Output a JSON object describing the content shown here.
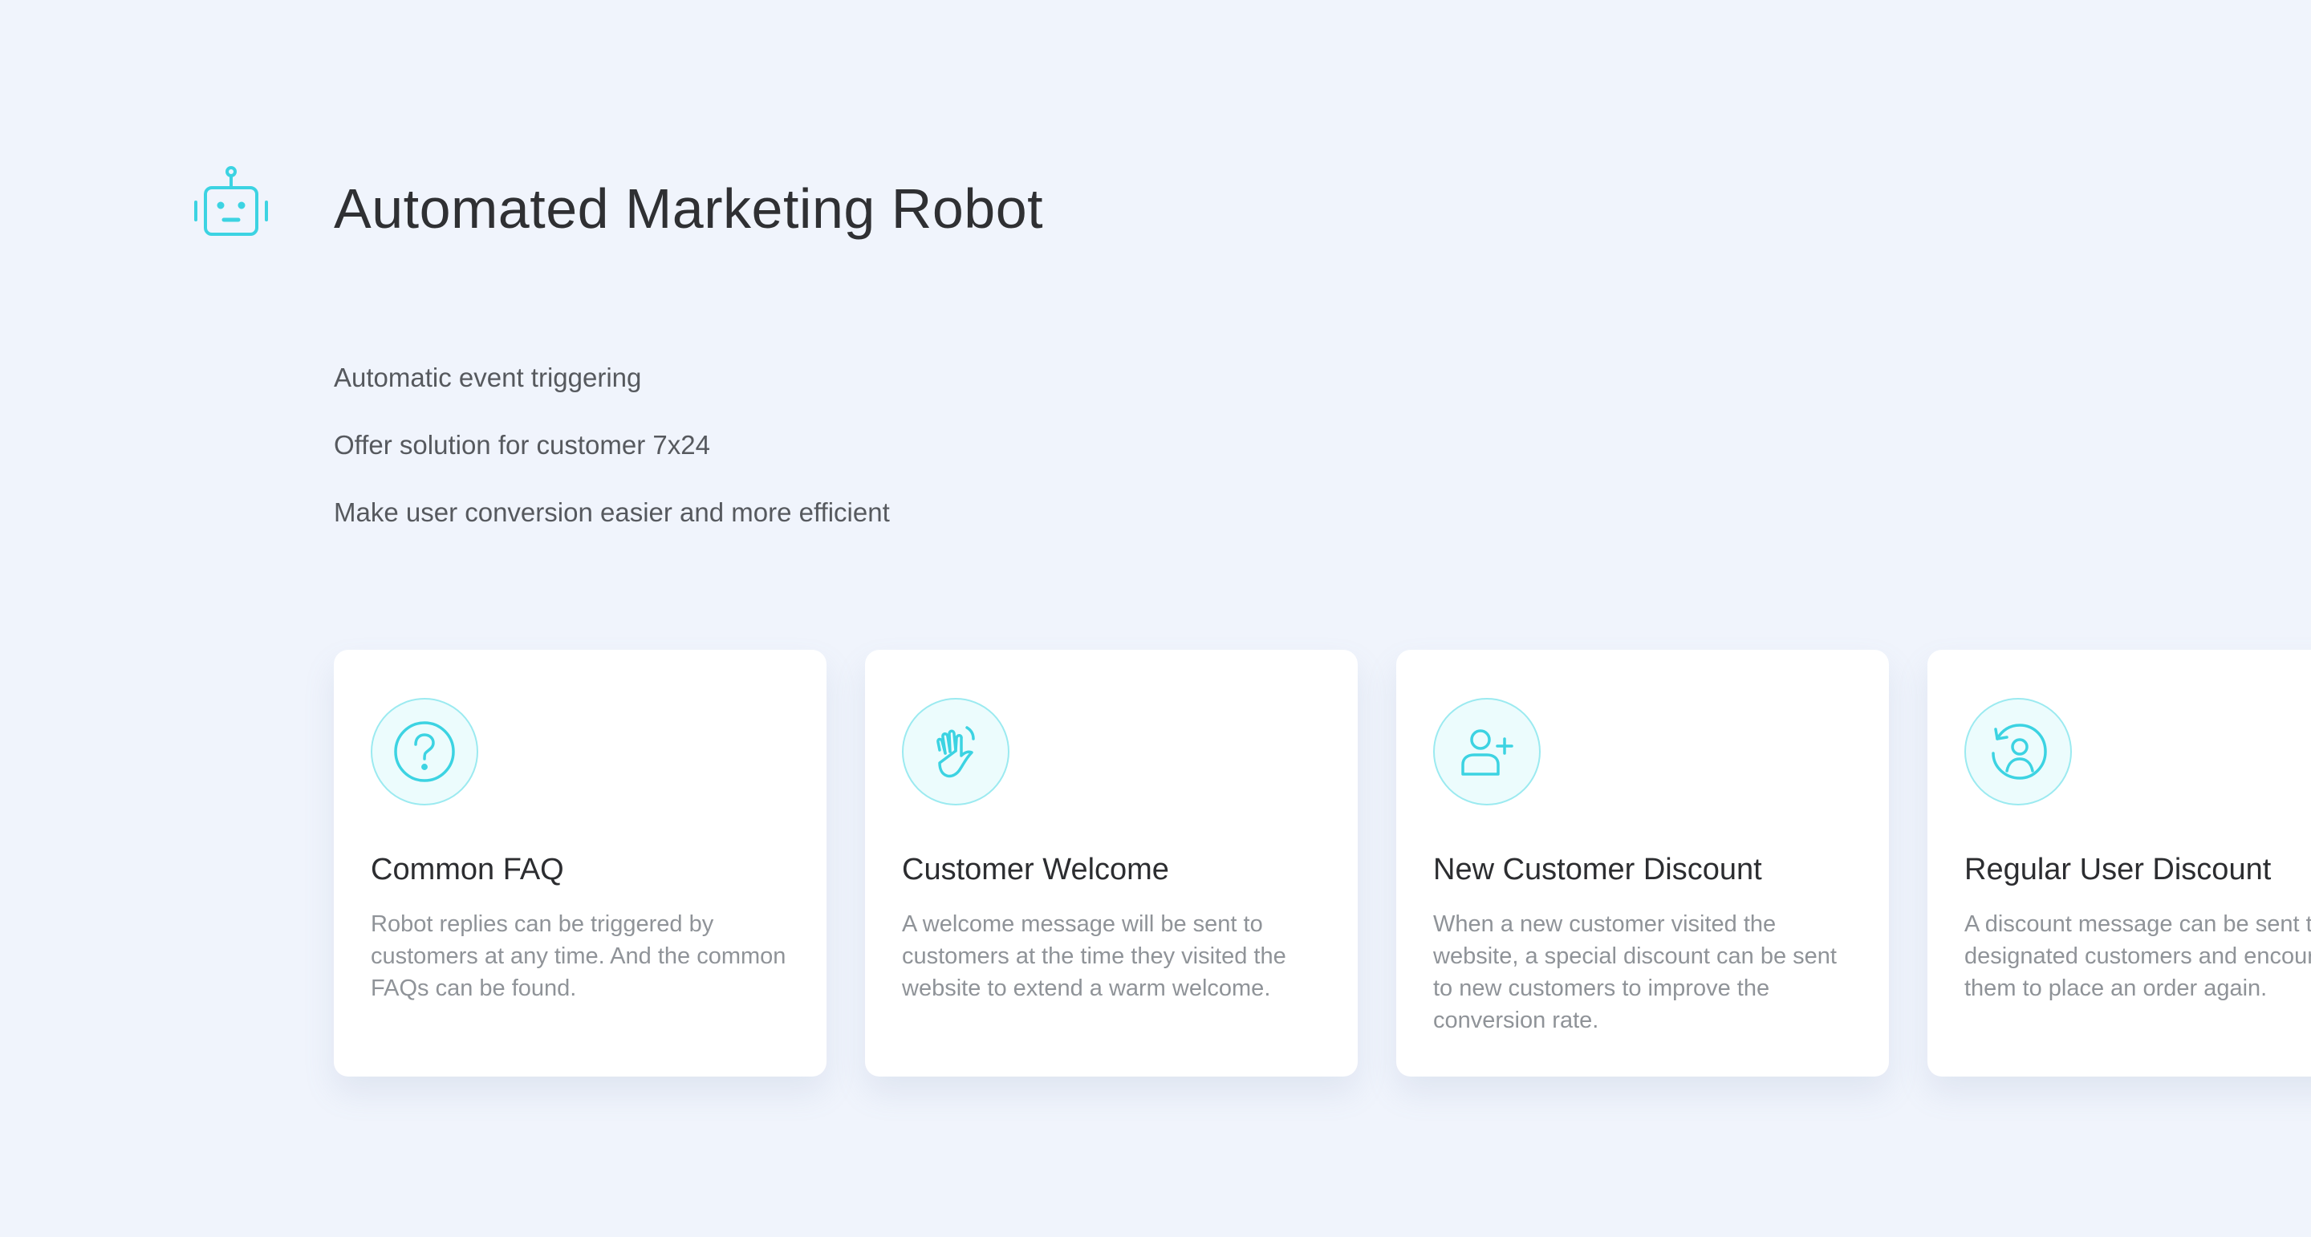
{
  "header": {
    "icon": "robot-icon",
    "title": "Automated Marketing Robot"
  },
  "features": [
    "Automatic event triggering",
    "Offer solution for customer 7x24",
    "Make user conversion easier and more efficient"
  ],
  "cards": [
    {
      "icon": "question-circle-icon",
      "title": "Common FAQ",
      "description": "Robot replies can be triggered by customers at any time. And the common FAQs can be found."
    },
    {
      "icon": "waving-hand-icon",
      "title": "Customer Welcome",
      "description": "A welcome message will be sent to customers at the time they visited the website to extend a warm welcome."
    },
    {
      "icon": "add-user-icon",
      "title": "New Customer Discount",
      "description": "When a new customer visited the website, a special discount can be sent to new customers to improve the conversion rate."
    },
    {
      "icon": "returning-user-icon",
      "title": "Regular User Discount",
      "description": "A discount message can be sent to designated customers and encourage them to place an order again."
    }
  ],
  "colors": {
    "accent": "#3cd3e2",
    "background": "#f0f4fc",
    "icon_circle_fill": "#ecfcfd",
    "icon_circle_border": "#9beaf0",
    "title_text": "#2f3033",
    "body_text": "#56595e",
    "muted_text": "#8f9398"
  }
}
